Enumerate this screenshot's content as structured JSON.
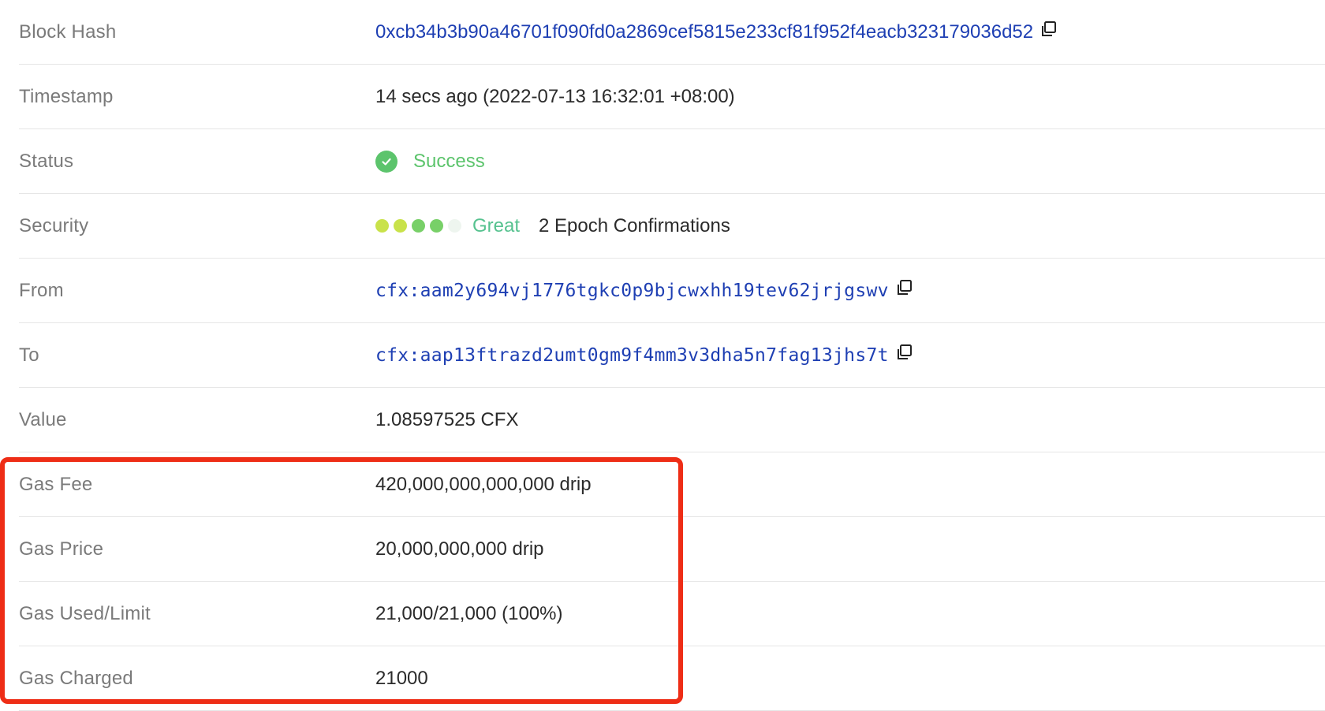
{
  "rows": [
    {
      "label": "Block Hash",
      "value": "0xcb34b3b90a46701f090fd0a2869cef5815e233cf81f952f4eacb323179036d52"
    },
    {
      "label": "Timestamp",
      "value": "14 secs ago (2022-07-13 16:32:01 +08:00)"
    },
    {
      "label": "Status",
      "value": "Success"
    },
    {
      "label": "Security",
      "level": "Great",
      "confirmations": "2 Epoch Confirmations",
      "filled_dots": 4,
      "total_dots": 5
    },
    {
      "label": "From",
      "value": "cfx:aam2y694vj1776tgkc0p9bjcwxhh19tev62jrjgswv"
    },
    {
      "label": "To",
      "value": "cfx:aap13ftrazd2umt0gm9f4mm3v3dha5n7fag13jhs7t"
    },
    {
      "label": "Value",
      "value": "1.08597525 CFX"
    },
    {
      "label": "Gas Fee",
      "value": "420,000,000,000,000 drip"
    },
    {
      "label": "Gas Price",
      "value": "20,000,000,000 drip"
    },
    {
      "label": "Gas Used/Limit",
      "value": "21,000/21,000 (100%)"
    },
    {
      "label": "Gas Charged",
      "value": "21000"
    }
  ],
  "icons": {
    "copy": "copy-icon",
    "status": "check-circle-icon"
  },
  "colors": {
    "link": "#1e3fb3",
    "success": "#5cc46c",
    "great": "#56c28f",
    "highlight": "#ee2d16",
    "security_dots": [
      "#c9e24a",
      "#c9e24a",
      "#78d068",
      "#78d068",
      "#eef5ef"
    ]
  }
}
